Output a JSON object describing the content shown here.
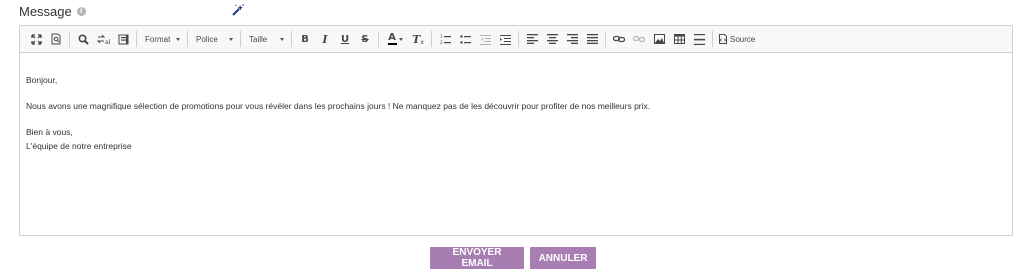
{
  "form": {
    "label": "Message",
    "info_icon": "i",
    "magic_icon": "magic-wand-icon"
  },
  "toolbar": {
    "format_label": "Format",
    "font_label": "Police",
    "size_label": "Taille",
    "bold": "B",
    "italic": "I",
    "underline": "U",
    "strike": "S",
    "text_color": "A",
    "remove_format": "T",
    "source_label": "Source"
  },
  "editor": {
    "greeting": "Bonjour,",
    "body": "Nous avons une magnifique sélection de promotions pour vous révéler dans les prochains jours ! Ne manquez pas de les découvrir pour profiter de nos meilleurs prix.",
    "closing": "Bien à vous,",
    "signature": "L'équipe de notre entreprise"
  },
  "actions": {
    "send_label": "ENVOYER EMAIL",
    "cancel_label": "ANNULER"
  },
  "colors": {
    "button_bg": "#a77db2",
    "toolbar_bg": "#f8f8f8",
    "border": "#d1d1d1"
  }
}
